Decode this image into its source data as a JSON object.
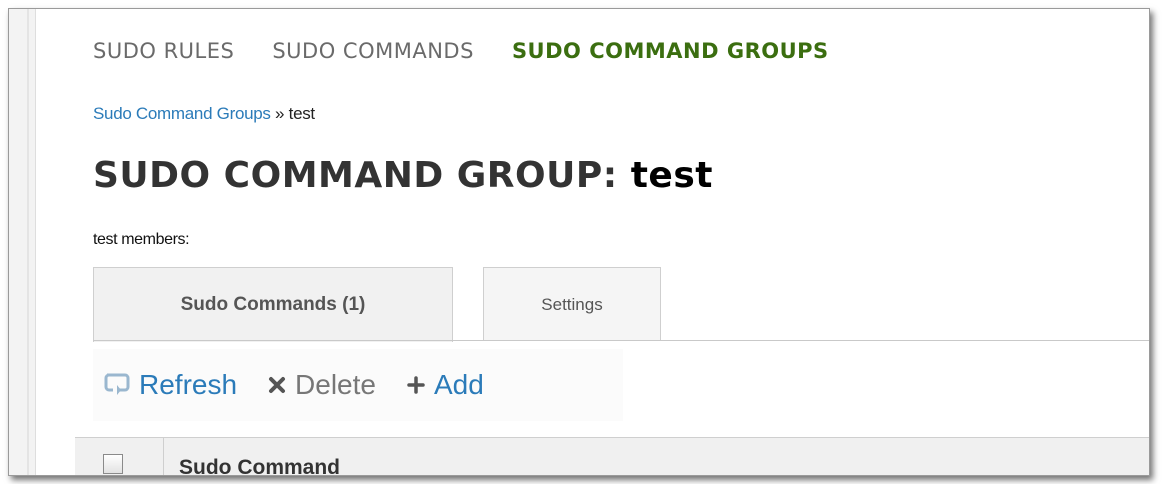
{
  "nav": {
    "tabs": [
      {
        "label": "SUDO RULES",
        "active": false
      },
      {
        "label": "SUDO COMMANDS",
        "active": false
      },
      {
        "label": "SUDO COMMAND GROUPS",
        "active": true
      }
    ]
  },
  "breadcrumb": {
    "parent": "Sudo Command Groups",
    "separator": " » ",
    "current": "test"
  },
  "title": {
    "prefix": "SUDO COMMAND GROUP:",
    "entity": "test"
  },
  "members_label": "test members:",
  "facet_tabs": [
    {
      "label": "Sudo Commands (1)",
      "active": true
    },
    {
      "label": "Settings",
      "active": false
    }
  ],
  "toolbar": {
    "refresh_label": "Refresh",
    "delete_label": "Delete",
    "add_label": "Add",
    "refresh_icon": "refresh-icon",
    "delete_icon": "close-icon",
    "add_icon": "plus-icon"
  },
  "table": {
    "columns": [
      "Sudo Command"
    ]
  },
  "colors": {
    "active_nav": "#3b6e10",
    "link": "#2b7bb9",
    "muted": "#777777"
  }
}
